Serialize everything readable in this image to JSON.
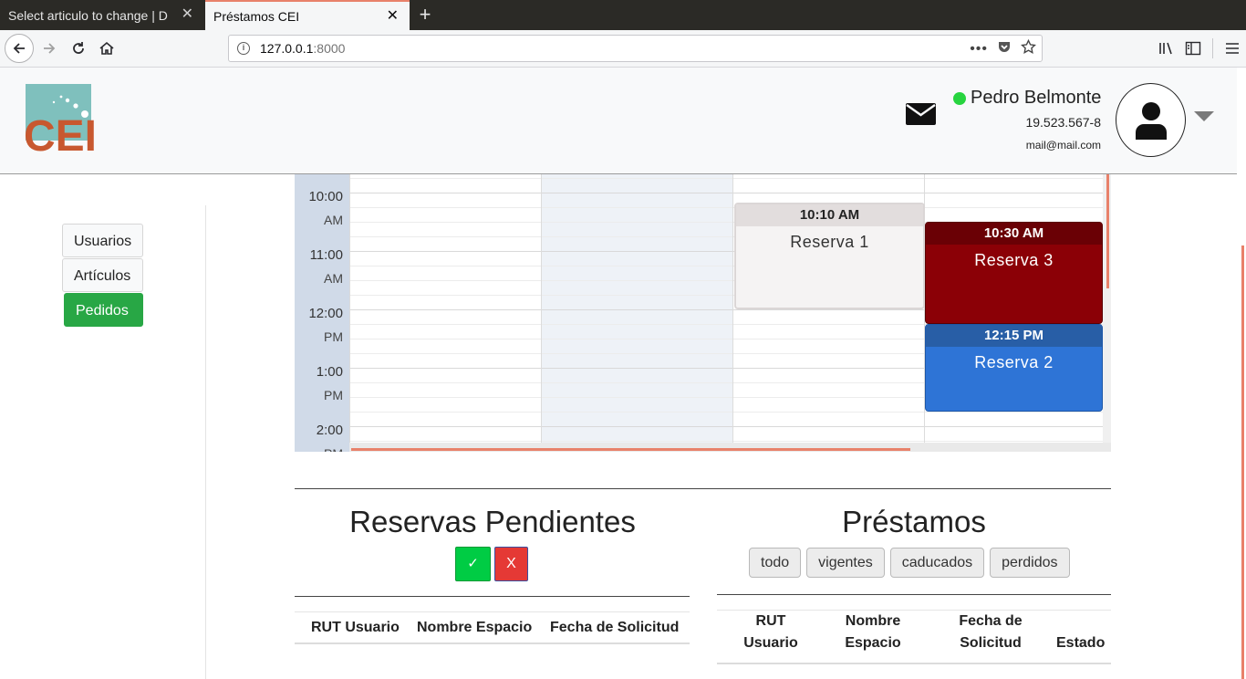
{
  "browser": {
    "tabs": [
      {
        "title": "Select articulo to change | D",
        "active": false
      },
      {
        "title": "Préstamos CEI",
        "active": true
      }
    ],
    "url_host": "127.0.0.1",
    "url_port": ":8000",
    "accent": "#e8816a"
  },
  "header": {
    "logo_text": "CEI",
    "user": {
      "name": "Pedro Belmonte",
      "rut": "19.523.567-8",
      "email": "mail@mail.com",
      "status": "online"
    },
    "icons": [
      "mail-icon",
      "user-avatar-icon",
      "caret-down-icon"
    ]
  },
  "sidebar": {
    "items": [
      {
        "label": "Usuarios",
        "active": false
      },
      {
        "label": "Artículos",
        "active": false
      },
      {
        "label": "Pedidos",
        "active": true
      }
    ]
  },
  "calendar": {
    "times": [
      {
        "time": "10:00",
        "ampm": "AM"
      },
      {
        "time": "11:00",
        "ampm": "AM"
      },
      {
        "time": "12:00",
        "ampm": "PM"
      },
      {
        "time": "1:00",
        "ampm": "PM"
      },
      {
        "time": "2:00",
        "ampm": "PM"
      }
    ],
    "events": [
      {
        "time": "10:10 AM",
        "title": "Reserva 1",
        "color": "#f5f3f3"
      },
      {
        "time": "10:30 AM",
        "title": "Reserva 3",
        "color": "#8b0006"
      },
      {
        "time": "12:15 PM",
        "title": "Reserva 2",
        "color": "#2e74d6"
      }
    ]
  },
  "reservas": {
    "title": "Reservas Pendientes",
    "approve_label": "✓",
    "reject_label": "X",
    "columns": [
      "RUT Usuario",
      "Nombre Espacio",
      "Fecha de Solicitud"
    ]
  },
  "prestamos": {
    "title": "Préstamos",
    "filters": [
      "todo",
      "vigentes",
      "caducados",
      "perdidos"
    ],
    "columns": [
      "RUT Usuario",
      "Nombre Espacio",
      "Fecha de Solicitud",
      "Estado"
    ]
  }
}
